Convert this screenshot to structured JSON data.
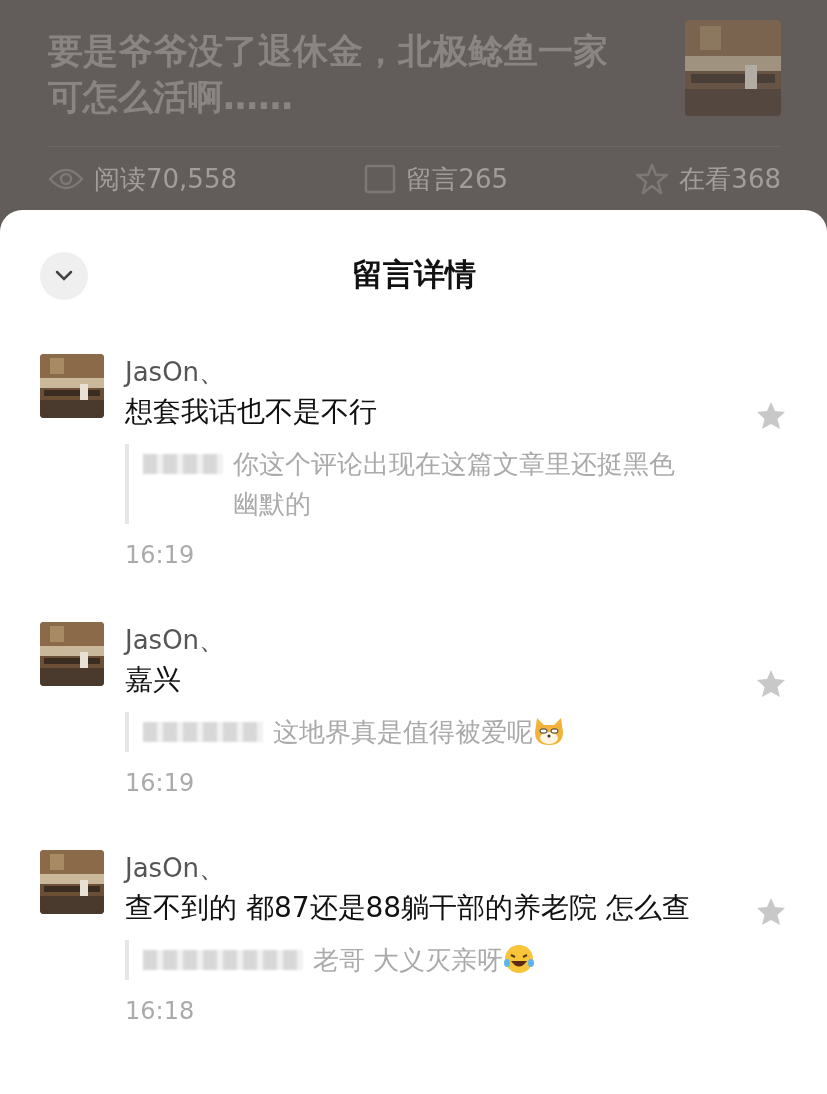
{
  "article": {
    "title": "要是爷爷没了退休金，北极鲶鱼一家可怎么活啊……",
    "stats": [
      {
        "kind": "reads",
        "label": "阅读70,558"
      },
      {
        "kind": "comments",
        "label": "留言265"
      },
      {
        "kind": "watching",
        "label": "在看368"
      }
    ]
  },
  "sheet": {
    "title": "留言详情"
  },
  "comments": [
    {
      "author": "JasOn、",
      "text": "想套我话也不是不行",
      "liked": false,
      "reply": {
        "text": "你这个评论出现在这篇文章里还挺黑色幽默的",
        "kind": "plain"
      },
      "time": "16:19"
    },
    {
      "author": "JasOn、",
      "text": "嘉兴",
      "liked": false,
      "reply": {
        "text": "这地界真是值得被爱呢",
        "kind": "dog"
      },
      "time": "16:19"
    },
    {
      "author": "JasOn、",
      "text": "查不到的 都87还是88躺干部的养老院 怎么查",
      "liked": false,
      "reply": {
        "text": "老哥 大义灭亲呀",
        "kind": "laugh"
      },
      "time": "16:18"
    }
  ]
}
